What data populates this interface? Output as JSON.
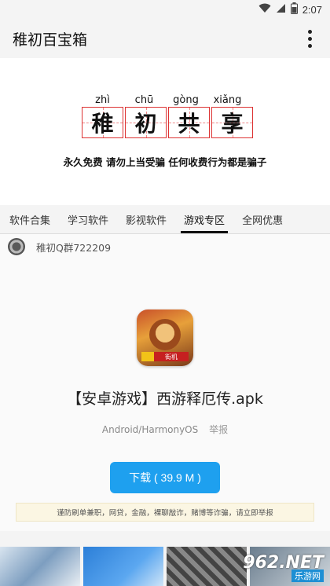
{
  "status": {
    "time": "2:07"
  },
  "appbar": {
    "title": "稚初百宝箱"
  },
  "banner": {
    "pinyin": [
      "zhì",
      "chū",
      "gòng",
      "xiǎng"
    ],
    "hanzi": [
      "稚",
      "初",
      "共",
      "享"
    ],
    "notice": "永久免费 请勿上当受骗 任何收费行为都是骗子"
  },
  "tabs": [
    {
      "label": "软件合集"
    },
    {
      "label": "学习软件"
    },
    {
      "label": "影视软件"
    },
    {
      "label": "游戏专区"
    },
    {
      "label": "全网优惠"
    }
  ],
  "active_tab": "游戏专区",
  "group": {
    "label": "稚初Q群722209"
  },
  "file": {
    "title": "【安卓游戏】西游释厄传.apk",
    "platform": "Android/HarmonyOS",
    "report": "举报",
    "download": "下载 ( 39.9 M )",
    "icon_badge": "街机"
  },
  "warning": "谨防刷单兼职，网贷，金融，裸聊敲诈，赌博等诈骗，请立即举报",
  "watermark": {
    "big": "962.NET",
    "small": "乐游网"
  }
}
